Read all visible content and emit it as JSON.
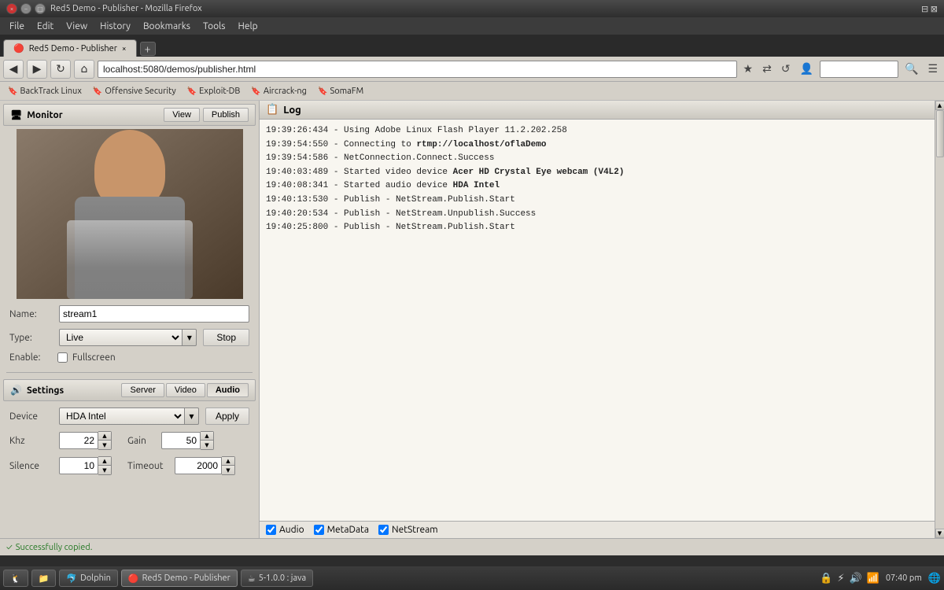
{
  "window": {
    "title": "Red5 Demo - Publisher - Mozilla Firefox",
    "tab_label": "Red5 Demo - Publisher"
  },
  "menubar": {
    "items": [
      "File",
      "Edit",
      "View",
      "History",
      "Bookmarks",
      "Tools",
      "Help"
    ]
  },
  "navbar": {
    "url": "localhost:5080/demos/publisher.html",
    "back_title": "back",
    "forward_title": "forward",
    "reload_title": "reload",
    "home_title": "home"
  },
  "bookmarks": [
    {
      "label": "BackTrack Linux",
      "icon": "🔖"
    },
    {
      "label": "Offensive Security",
      "icon": "🔖"
    },
    {
      "label": "Exploit-DB",
      "icon": "🔖"
    },
    {
      "label": "Aircrack-ng",
      "icon": "🔖"
    },
    {
      "label": "SomaFM",
      "icon": "🔖"
    }
  ],
  "monitor": {
    "title": "Monitor",
    "icon": "🖥",
    "view_btn": "View",
    "publish_btn": "Publish",
    "name_label": "Name:",
    "name_value": "stream1",
    "type_label": "Type:",
    "type_value": "Live",
    "stop_btn": "Stop",
    "enable_label": "Enable:",
    "fullscreen_label": "Fullscreen"
  },
  "settings": {
    "title": "Settings",
    "icon": "🔊",
    "server_tab": "Server",
    "video_tab": "Video",
    "audio_tab": "Audio",
    "device_label": "Device",
    "device_value": "HDA Intel",
    "apply_btn": "Apply",
    "khz_label": "Khz",
    "khz_value": "22",
    "gain_label": "Gain",
    "gain_value": "50",
    "silence_label": "Silence",
    "silence_value": "10",
    "timeout_label": "Timeout",
    "timeout_value": "2000"
  },
  "log": {
    "title": "Log",
    "icon": "📋",
    "entries": [
      {
        "time": "19:39:26:434",
        "text": " - Using Adobe Linux Flash Player 11.2.202.258",
        "bold": ""
      },
      {
        "time": "19:39:54:550",
        "text": " - Connecting to ",
        "bold": "rtmp://localhost/oflaDemo"
      },
      {
        "time": "19:39:54:586",
        "text": " - NetConnection.Connect.Success",
        "bold": ""
      },
      {
        "time": "19:40:03:489",
        "text": " - Started video device ",
        "bold": "Acer HD Crystal Eye webcam (V4L2)"
      },
      {
        "time": "19:40:08:341",
        "text": " - Started audio device ",
        "bold": "HDA Intel"
      },
      {
        "time": "19:40:13:530",
        "text": " - Publish - NetStream.Publish.Start",
        "bold": ""
      },
      {
        "time": "19:40:20:534",
        "text": " - Publish - NetStream.Unpublish.Success",
        "bold": ""
      },
      {
        "time": "19:40:25:800",
        "text": " - Publish - NetStream.Publish.Start",
        "bold": ""
      }
    ],
    "footer_checkboxes": [
      "Audio",
      "MetaData",
      "NetStream"
    ]
  },
  "status_bar": {
    "message": "Successfully copied."
  },
  "taskbar": {
    "apps": [
      {
        "label": "Dolphin",
        "active": false
      },
      {
        "label": "Red5 Demo - Publisher",
        "active": true
      },
      {
        "label": "5-1.0.0 : java",
        "active": false
      }
    ],
    "time": "07:40 pm",
    "icons": [
      "🔇",
      "⚡",
      "🌐",
      "🔒"
    ]
  }
}
